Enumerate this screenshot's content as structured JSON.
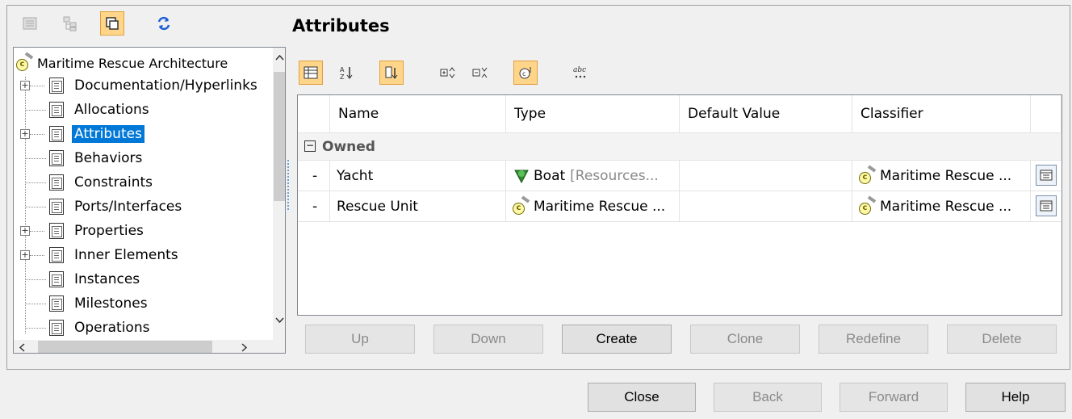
{
  "toolbar_left": {
    "icons": [
      "details-icon",
      "tree-icon",
      "window-icon",
      "refresh-icon"
    ]
  },
  "tree": {
    "root": "Maritime Rescue Architecture",
    "items": [
      {
        "label": "Documentation/Hyperlinks",
        "expandable": true
      },
      {
        "label": "Allocations",
        "expandable": false
      },
      {
        "label": "Attributes",
        "expandable": true,
        "selected": true
      },
      {
        "label": "Behaviors",
        "expandable": false
      },
      {
        "label": "Constraints",
        "expandable": false
      },
      {
        "label": "Ports/Interfaces",
        "expandable": false
      },
      {
        "label": "Properties",
        "expandable": true
      },
      {
        "label": "Inner Elements",
        "expandable": true
      },
      {
        "label": "Instances",
        "expandable": false
      },
      {
        "label": "Milestones",
        "expandable": false
      },
      {
        "label": "Operations",
        "expandable": false
      }
    ]
  },
  "section": {
    "title": "Attributes"
  },
  "grid": {
    "columns": [
      "Name",
      "Type",
      "Default Value",
      "Classifier"
    ],
    "group_label": "Owned",
    "rows": [
      {
        "marker": "-",
        "name": "Yacht",
        "type": "Boat",
        "type_extra": "[Resources...",
        "default": "",
        "classifier": "Maritime Rescue ..."
      },
      {
        "marker": "-",
        "name": "Rescue Unit",
        "type": "Maritime Rescue ...",
        "type_extra": "",
        "default": "",
        "classifier": "Maritime Rescue ..."
      }
    ]
  },
  "action_buttons": {
    "up": "Up",
    "down": "Down",
    "create": "Create",
    "clone": "Clone",
    "redefine": "Redefine",
    "delete": "Delete"
  },
  "dialog_buttons": {
    "close": "Close",
    "back": "Back",
    "forward": "Forward",
    "help": "Help"
  },
  "colors": {
    "selection": "#0078d7",
    "toggle_active": "#ffd58a"
  }
}
